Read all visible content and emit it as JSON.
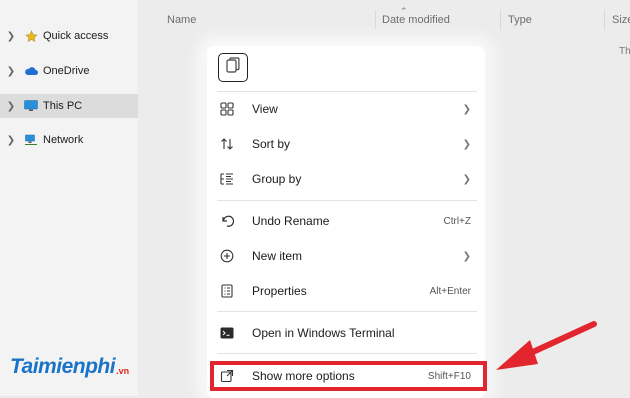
{
  "nav": {
    "items": [
      {
        "label": "Quick access",
        "icon": "star-icon"
      },
      {
        "label": "OneDrive",
        "icon": "cloud-icon"
      },
      {
        "label": "This PC",
        "icon": "monitor-icon"
      },
      {
        "label": "Network",
        "icon": "network-icon"
      }
    ]
  },
  "columns": {
    "name": "Name",
    "date": "Date modified",
    "type": "Type",
    "size": "Size"
  },
  "content": {
    "cut_text": "Th"
  },
  "watermark": {
    "brand": "Taimienphi",
    "tld": ".vn"
  },
  "menu": {
    "copy_icon": "copy-icon",
    "items": [
      {
        "label": "View",
        "icon": "grid-icon",
        "shortcut": "",
        "submenu": true
      },
      {
        "label": "Sort by",
        "icon": "sort-icon",
        "shortcut": "",
        "submenu": true
      },
      {
        "label": "Group by",
        "icon": "list-icon",
        "shortcut": "",
        "submenu": true
      },
      {
        "label": "Undo Rename",
        "icon": "undo-icon",
        "shortcut": "Ctrl+Z",
        "submenu": false
      },
      {
        "label": "New item",
        "icon": "plus-circle-icon",
        "shortcut": "",
        "submenu": true
      },
      {
        "label": "Properties",
        "icon": "properties-icon",
        "shortcut": "Alt+Enter",
        "submenu": false
      },
      {
        "label": "Open in Windows Terminal",
        "icon": "terminal-icon",
        "shortcut": "",
        "submenu": false
      },
      {
        "label": "Show more options",
        "icon": "share-icon",
        "shortcut": "Shift+F10",
        "submenu": false
      }
    ]
  },
  "colors": {
    "highlight": "#e3262d",
    "accent": "#1a73c8"
  }
}
